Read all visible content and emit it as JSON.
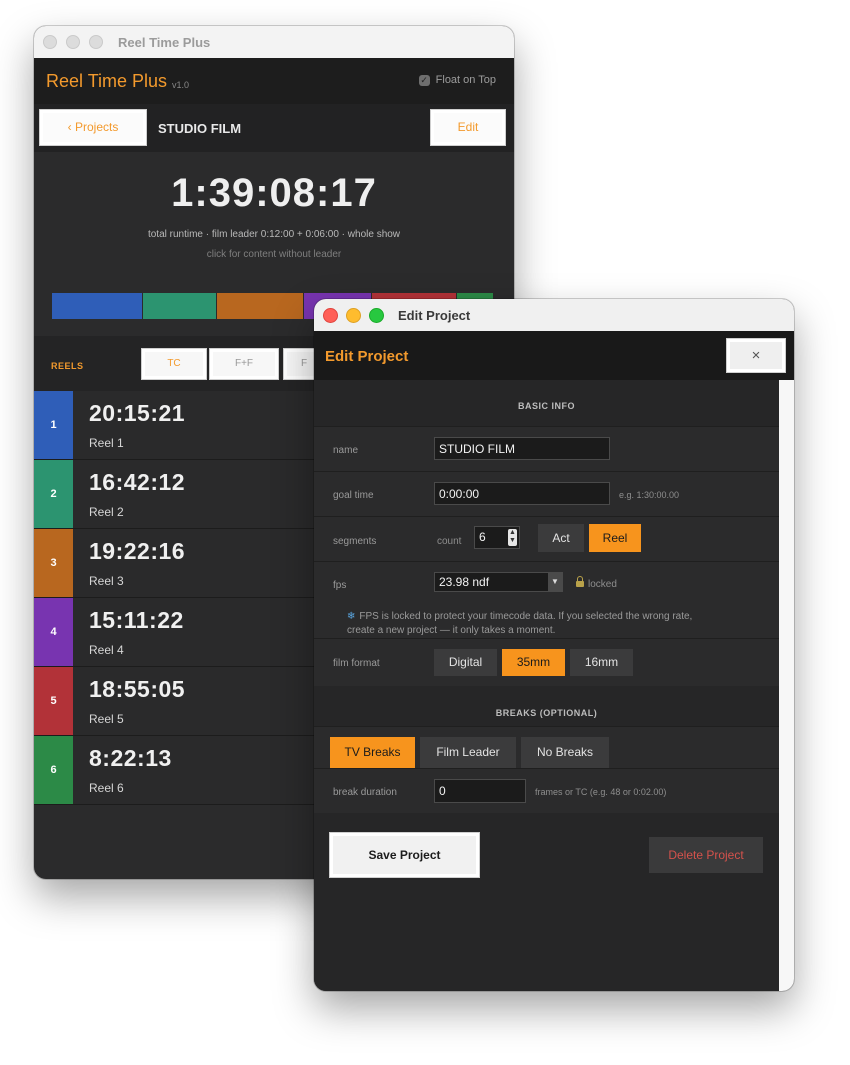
{
  "main_window": {
    "title": "Reel Time Plus",
    "app_name": "Reel Time Plus",
    "version": "v1.0",
    "float_on_top": {
      "label": "Float on Top",
      "checked": true
    },
    "back_button": "‹ Projects",
    "project_name": "STUDIO FILM",
    "edit_button": "Edit",
    "total_runtime": "1:39:08:17",
    "runtime_details": "total runtime  ·  film leader 0:12:00 + 0:06:00  ·  whole show",
    "runtime_hint": "click for content without leader",
    "reels_label": "REELS",
    "format_buttons": [
      "TC",
      "F+F",
      "F"
    ],
    "active_format": "TC",
    "reels": [
      {
        "num": "1",
        "time": "20:15:21",
        "name": "Reel 1",
        "color": "#2f5eb8"
      },
      {
        "num": "2",
        "time": "16:42:12",
        "name": "Reel 2",
        "color": "#2c9470"
      },
      {
        "num": "3",
        "time": "19:22:16",
        "name": "Reel 3",
        "color": "#b8671f"
      },
      {
        "num": "4",
        "time": "15:11:22",
        "name": "Reel 4",
        "color": "#7834b0"
      },
      {
        "num": "5",
        "time": "18:55:05",
        "name": "Reel 5",
        "color": "#b23238"
      },
      {
        "num": "6",
        "time": "8:22:13",
        "name": "Reel 6",
        "color": "#2c8a47"
      }
    ]
  },
  "edit_window": {
    "title": "Edit Project",
    "header": "Edit Project",
    "close_glyph": "×",
    "basic_info_heading": "BASIC INFO",
    "name_label": "name",
    "name_value": "STUDIO FILM",
    "goal_label": "goal time",
    "goal_value": "0:00:00",
    "goal_hint": "e.g. 1:30:00.00",
    "segments_label": "segments",
    "count_label": "count",
    "count_value": "6",
    "segment_types": [
      "Act",
      "Reel"
    ],
    "active_segment_type": "Reel",
    "fps_label": "fps",
    "fps_value": "23.98 ndf",
    "fps_locked": "locked",
    "fps_note_line1": "FPS is locked to protect your timecode data. If you selected the wrong rate,",
    "fps_note_line2": "create a new project — it only takes a moment.",
    "film_format_label": "film format",
    "film_formats": [
      "Digital",
      "35mm",
      "16mm"
    ],
    "active_film_format": "35mm",
    "breaks_heading": "BREAKS  (OPTIONAL)",
    "break_types": [
      "TV Breaks",
      "Film Leader",
      "No Breaks"
    ],
    "active_break_type": "TV Breaks",
    "break_duration_label": "break duration",
    "break_duration_value": "0",
    "break_duration_hint": "frames or TC (e.g. 48  or  0:02.00)",
    "save_button": "Save Project",
    "delete_button": "Delete Project"
  },
  "colors": {
    "accent": "#f39a2d",
    "delete": "#d5524c"
  }
}
